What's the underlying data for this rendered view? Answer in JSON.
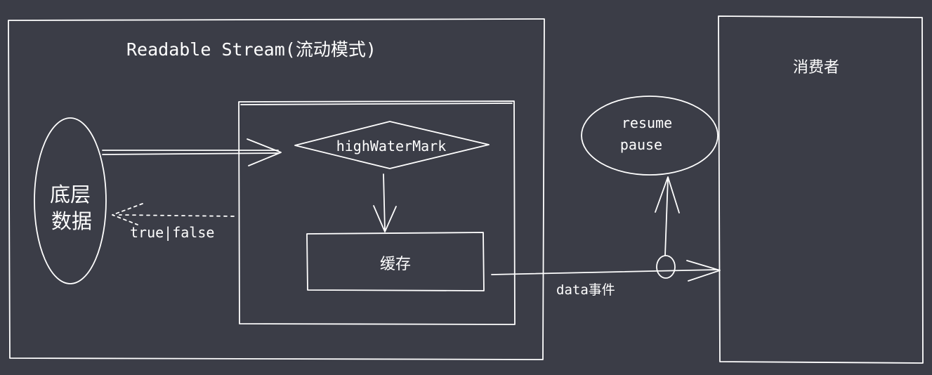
{
  "diagram": {
    "readable_stream_title": "Readable Stream(流动模式)",
    "underlying_data": [
      "底层",
      "数据"
    ],
    "high_water_mark": "highWaterMark",
    "buffer": "缓存",
    "feedback": "true|false",
    "consumer": "消费者",
    "controls": [
      "resume",
      "pause"
    ],
    "data_event": "data事件"
  }
}
